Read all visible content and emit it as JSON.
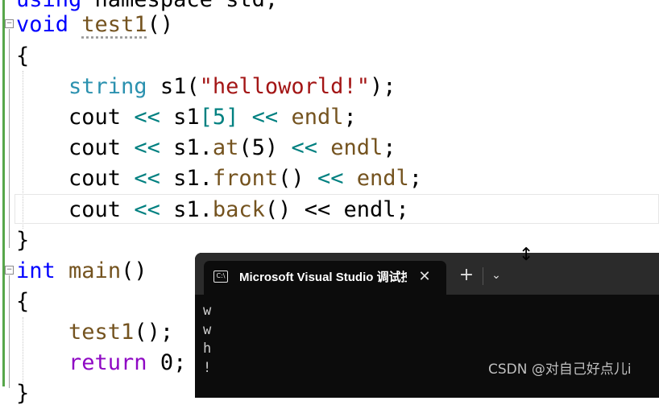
{
  "editor": {
    "line0": {
      "kw": "using",
      "rest": " namespace std;"
    },
    "line1": {
      "kw": "void",
      "fn": "test1",
      "paren": "()"
    },
    "line2": {
      "text": "{"
    },
    "line3": {
      "type": "string",
      "var": "s1",
      "open": "(",
      "str": "\"helloworld!\"",
      "close": ");"
    },
    "line4": {
      "cout": "cout",
      "op1": "<<",
      "obj": "s1",
      "idx": "[5]",
      "op2": "<<",
      "endl": "endl",
      "semi": ";"
    },
    "line5": {
      "cout": "cout",
      "op1": "<<",
      "obj": "s1",
      "dot": ".",
      "method": "at",
      "args": "(5)",
      "op2": "<<",
      "endl": "endl",
      "semi": ";"
    },
    "line6": {
      "cout": "cout",
      "op1": "<<",
      "obj": "s1",
      "dot": ".",
      "method": "front",
      "args": "()",
      "op2": "<<",
      "endl": "endl",
      "semi": ";"
    },
    "line7": {
      "cout": "cout",
      "op1": "<<",
      "obj": "s1",
      "dot": ".",
      "method": "back",
      "args": "()",
      "op2": "<<",
      "endl": "endl",
      "semi": ";"
    },
    "line8": {
      "text": "}"
    },
    "line9": {
      "kw": "int",
      "fn": "main",
      "paren": "()"
    },
    "line10": {
      "text": "{"
    },
    "line11": {
      "fn": "test1",
      "rest": "();"
    },
    "line12": {
      "kw": "return",
      "rest": " 0;"
    },
    "fold_minus": "−",
    "close_brace_partial": "}"
  },
  "terminal": {
    "tab_title": "Microsoft Visual Studio 调试控制台",
    "tab_icon_label": "C:\\",
    "close_glyph": "✕",
    "new_tab_glyph": "+",
    "dropdown_glyph": "⌄",
    "output": [
      "w",
      "w",
      "h",
      "!"
    ]
  },
  "cursor_glyph": "↕",
  "watermark": "CSDN @对自己好点儿i",
  "colors": {
    "keyword": "#0000ff",
    "type": "#2b91af",
    "function": "#74531f",
    "string": "#a31515",
    "operator": "#008080",
    "return": "#8f08c4",
    "terminal_bg": "#0c0c0c",
    "titlebar_bg": "#2b2b2b"
  }
}
